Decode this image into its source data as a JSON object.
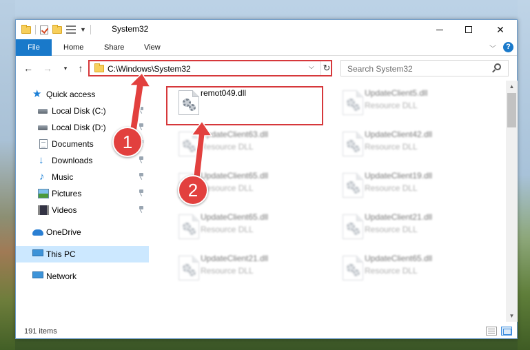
{
  "window": {
    "title": "System32"
  },
  "ribbon": {
    "tabs": [
      {
        "label": "File"
      },
      {
        "label": "Home"
      },
      {
        "label": "Share"
      },
      {
        "label": "View"
      }
    ]
  },
  "address": {
    "path": "C:\\Windows\\System32"
  },
  "search": {
    "placeholder": "Search System32"
  },
  "sidebar": {
    "items": [
      {
        "label": "Quick access",
        "icon": "star-icon"
      },
      {
        "label": "Local Disk (C:)",
        "icon": "drive-icon",
        "pinned": true
      },
      {
        "label": "Local Disk (D:)",
        "icon": "drive-icon",
        "pinned": true
      },
      {
        "label": "Documents",
        "icon": "documents-icon",
        "pinned": true
      },
      {
        "label": "Downloads",
        "icon": "downloads-icon",
        "pinned": true
      },
      {
        "label": "Music",
        "icon": "music-icon",
        "pinned": true
      },
      {
        "label": "Pictures",
        "icon": "pictures-icon",
        "pinned": true
      },
      {
        "label": "Videos",
        "icon": "videos-icon",
        "pinned": true
      },
      {
        "label": "OneDrive",
        "icon": "cloud-icon"
      },
      {
        "label": "This PC",
        "icon": "computer-icon",
        "selected": true
      },
      {
        "label": "Network",
        "icon": "network-icon"
      }
    ]
  },
  "files": [
    {
      "name": "remot049.dll",
      "type": "",
      "highlighted": true
    },
    {
      "name": "UpdateClient5.dll",
      "type": "Resource DLL"
    },
    {
      "name": "UpdateClient63.dll",
      "type": "Resource DLL"
    },
    {
      "name": "UpdateClient42.dll",
      "type": "Resource DLL"
    },
    {
      "name": "UpdateClient65.dll",
      "type": "Resource DLL"
    },
    {
      "name": "UpdateClient19.dll",
      "type": "Resource DLL"
    },
    {
      "name": "UpdateClient65.dll",
      "type": "Resource DLL"
    },
    {
      "name": "UpdateClient21.dll",
      "type": "Resource DLL"
    },
    {
      "name": "UpdateClient21.dll",
      "type": "Resource DLL"
    },
    {
      "name": "UpdateClient65.dll",
      "type": "Resource DLL"
    }
  ],
  "status": {
    "item_count": "191 items"
  },
  "callouts": {
    "step1": "1",
    "step2": "2"
  },
  "colors": {
    "accent": "#1979ca",
    "highlight_red": "#d6383b",
    "callout_red": "#e2403e",
    "selected_bg": "#cce8ff"
  }
}
